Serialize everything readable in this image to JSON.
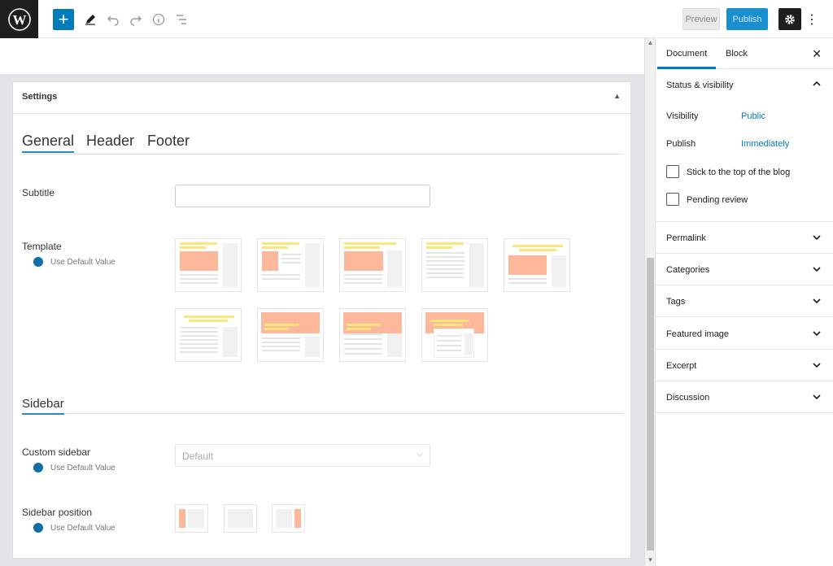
{
  "toolbar": {
    "add_label": "+",
    "preview_label": "Preview",
    "publish_label": "Publish",
    "more_label": "⋮"
  },
  "settings_panel": {
    "title": "Settings",
    "tabs": [
      {
        "label": "General",
        "active": true
      },
      {
        "label": "Header",
        "active": false
      },
      {
        "label": "Footer",
        "active": false
      }
    ],
    "subtitle_label": "Subtitle",
    "subtitle_value": "",
    "template_label": "Template",
    "use_default": "Use Default Value",
    "sidebar_section": "Sidebar",
    "custom_sidebar_label": "Custom sidebar",
    "custom_sidebar_value": "Default",
    "sidebar_position_label": "Sidebar position"
  },
  "doc_sidebar": {
    "tabs": [
      {
        "label": "Document",
        "active": true
      },
      {
        "label": "Block",
        "active": false
      }
    ],
    "close_label": "✕",
    "status_title": "Status & visibility",
    "visibility_label": "Visibility",
    "visibility_value": "Public",
    "publish_label": "Publish",
    "publish_value": "Immediately",
    "sticky_label": "Stick to the top of the blog",
    "pending_label": "Pending review",
    "sections": [
      "Permalink",
      "Categories",
      "Tags",
      "Featured image",
      "Excerpt",
      "Discussion"
    ]
  },
  "colors": {
    "accent": "#007cba",
    "header_orange": "#fdb79b",
    "title_yellow": "#fbe67e"
  }
}
